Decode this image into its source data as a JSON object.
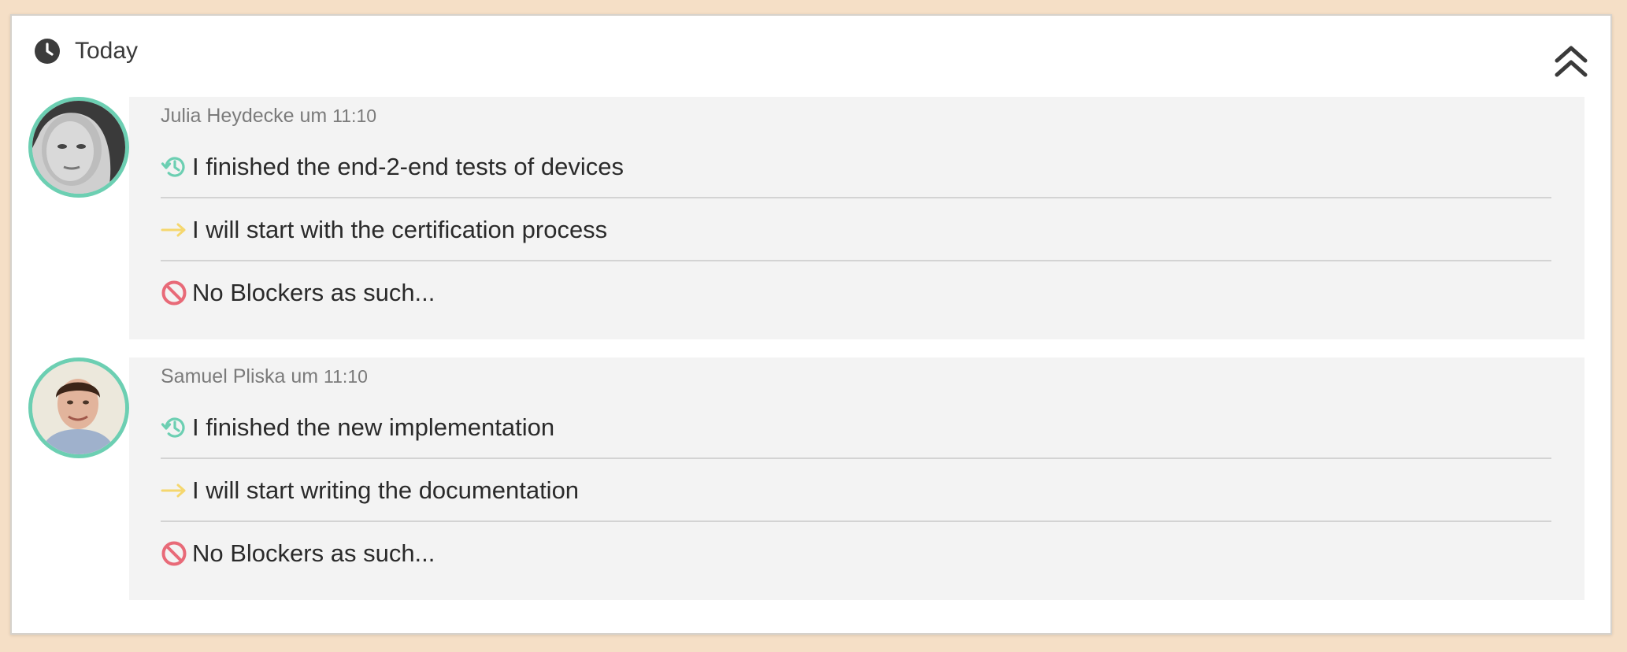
{
  "header": {
    "title": "Today",
    "icon": "clock-icon",
    "collapse_icon": "double-chevron-up-icon"
  },
  "colors": {
    "done": "#6ccfb2",
    "next": "#f5d76e",
    "blocker": "#e86a78",
    "avatar_ring": "#6ccfb2"
  },
  "entries": [
    {
      "author": "Julia Heydecke",
      "connector": "um",
      "time": "11:10",
      "done": "I finished the end-2-end tests of devices",
      "next": "I will start with the certification process",
      "blockers": "No Blockers as such..."
    },
    {
      "author": "Samuel Pliska",
      "connector": "um",
      "time": "11:10",
      "done": "I finished the new implementation",
      "next": "I will start writing the documentation",
      "blockers": "No Blockers as such..."
    }
  ]
}
